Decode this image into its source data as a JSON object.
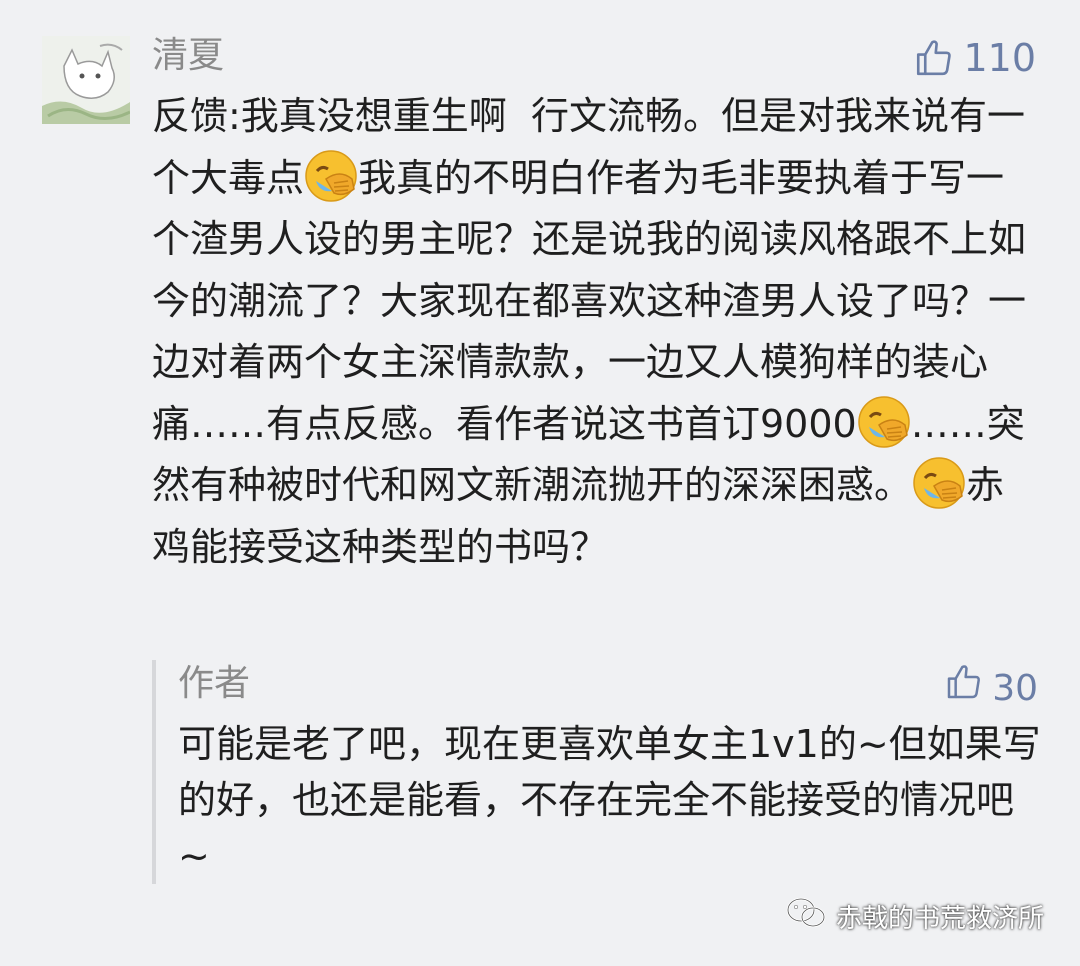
{
  "comment": {
    "username": "清夏",
    "likes": "110",
    "text_segments": [
      "反馈:我真没想重生啊  行文流畅。但是对我来说有一个大毒点",
      "我真的不明白作者为毛非要执着于写一个渣男人设的男主呢？还是说我的阅读风格跟不上如今的潮流了？大家现在都喜欢这种渣男人设了吗？一边对着两个女主深情款款，一边又人模狗样的装心痛……有点反感。看作者说这书首订9000",
      "……突然有种被时代和网文新潮流抛开的深深困惑。",
      "赤鸡能接受这种类型的书吗？"
    ]
  },
  "reply": {
    "author": "作者",
    "likes": "30",
    "text": "可能是老了吧，现在更喜欢单女主1v1的~但如果写的好，也还是能看，不存在完全不能接受的情况吧~"
  },
  "watermark": {
    "text": "赤戟的书荒救济所"
  },
  "icons": {
    "like": "thumbs-up-icon",
    "emoji": "face-palm-emoji",
    "watermark": "wechat-icon"
  },
  "colors": {
    "background": "#f0f1f3",
    "like_accent": "#6b7ea6",
    "username": "#8a8a8a",
    "text": "#1f1f1f"
  }
}
